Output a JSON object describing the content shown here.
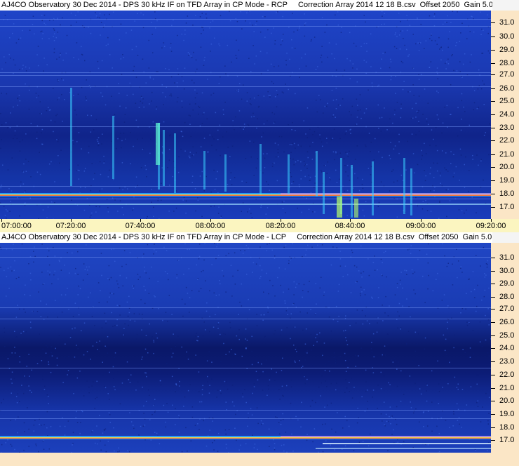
{
  "colors": {
    "spectrogram_base": "#1d3ec0",
    "freq_axis_bg": "#fbe6c6",
    "time_axis_bg": "#fbf5c0"
  },
  "top_panel": {
    "title": "AJ4CO Observatory 30 Dec 2014 - DPS 30 kHz IF on TFD Array in CP Mode - RCP     Correction Array 2014 12 18 B.csv  Offset 2050  Gain 5.0",
    "freq_labels": [
      "31.0",
      "30.0",
      "29.0",
      "28.0",
      "27.0",
      "26.0",
      "25.0",
      "24.0",
      "23.0",
      "22.0",
      "21.0",
      "20.0",
      "19.0",
      "18.0",
      "17.0"
    ],
    "time_labels": [
      "07:00:00",
      "07:20:00",
      "07:40:00",
      "08:00:00",
      "08:20:00",
      "08:40:00",
      "09:00:00",
      "09:20:00"
    ]
  },
  "bottom_panel": {
    "title": "AJ4CO Observatory 30 Dec 2014 - DPS 30 kHz IF on TFD Array in CP Mode - LCP     Correction Array 2014 12 18 B.csv  Offset 2050  Gain 5.0",
    "freq_labels": [
      "31.0",
      "30.0",
      "29.0",
      "28.0",
      "27.0",
      "26.0",
      "25.0",
      "24.0",
      "23.0",
      "22.0",
      "21.0",
      "20.0",
      "19.0",
      "18.0",
      "17.0"
    ]
  }
}
